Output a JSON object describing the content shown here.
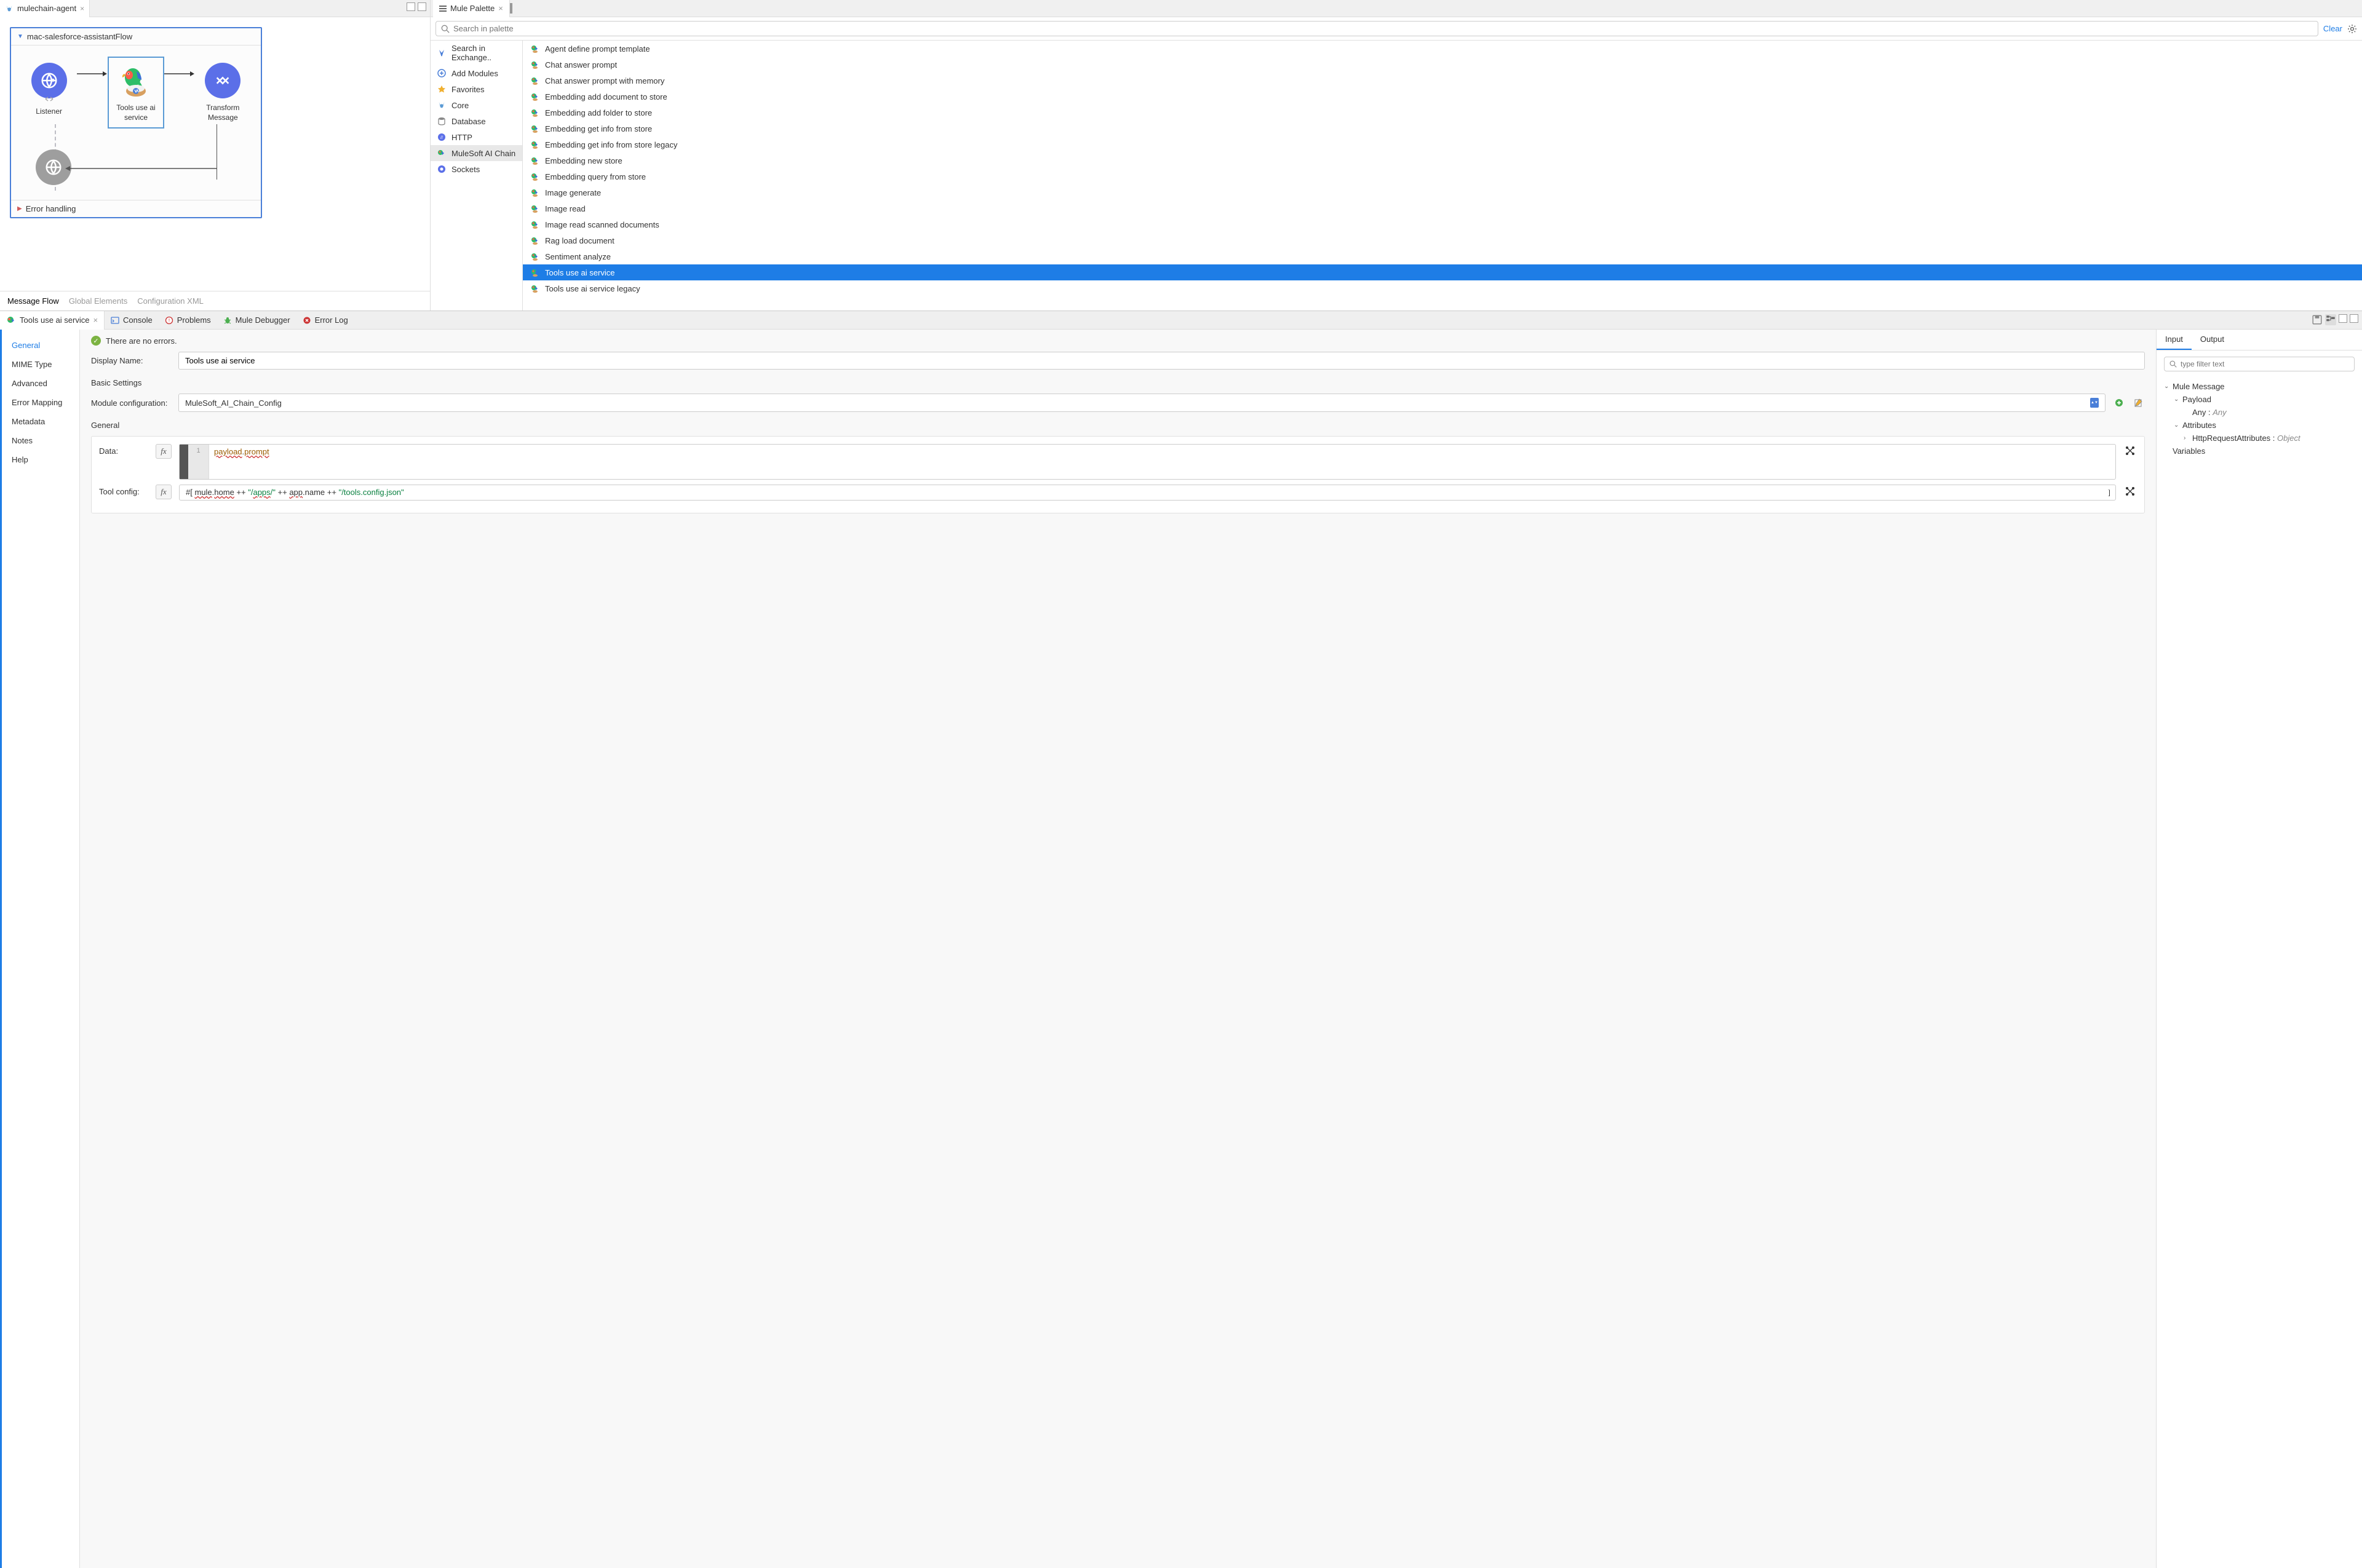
{
  "editor": {
    "tab_label": "mulechain-agent",
    "flow_name": "mac-salesforce-assistantFlow",
    "nodes": {
      "listener": "Listener",
      "tools": "Tools use ai service",
      "transform": "Transform Message"
    },
    "error_handling": "Error handling",
    "bottom_tabs": [
      "Message Flow",
      "Global Elements",
      "Configuration XML"
    ]
  },
  "palette": {
    "title": "Mule Palette",
    "search_placeholder": "Search in palette",
    "clear": "Clear",
    "left": [
      {
        "label": "Search in Exchange.."
      },
      {
        "label": "Add Modules"
      },
      {
        "label": "Favorites"
      },
      {
        "label": "Core"
      },
      {
        "label": "Database"
      },
      {
        "label": "HTTP"
      },
      {
        "label": "MuleSoft AI Chain",
        "selected": true
      },
      {
        "label": "Sockets"
      }
    ],
    "right": [
      {
        "label": "Agent define prompt template"
      },
      {
        "label": "Chat answer prompt"
      },
      {
        "label": "Chat answer prompt with memory"
      },
      {
        "label": "Embedding add document to store"
      },
      {
        "label": "Embedding add folder to store"
      },
      {
        "label": "Embedding get info from store"
      },
      {
        "label": "Embedding get info from store legacy"
      },
      {
        "label": "Embedding new store"
      },
      {
        "label": "Embedding query from store"
      },
      {
        "label": "Image generate"
      },
      {
        "label": "Image read"
      },
      {
        "label": "Image read scanned documents"
      },
      {
        "label": "Rag load document"
      },
      {
        "label": "Sentiment analyze"
      },
      {
        "label": "Tools use ai service",
        "selected": true
      },
      {
        "label": "Tools use ai service legacy"
      }
    ]
  },
  "properties": {
    "tab_label": "Tools use ai service",
    "view_tabs": [
      "Console",
      "Problems",
      "Mule Debugger",
      "Error Log"
    ],
    "sidebar": [
      "General",
      "MIME Type",
      "Advanced",
      "Error Mapping",
      "Metadata",
      "Notes",
      "Help"
    ],
    "no_errors": "There are no errors.",
    "display_name_label": "Display Name:",
    "display_name_value": "Tools use ai service",
    "basic_settings": "Basic Settings",
    "module_config_label": "Module configuration:",
    "module_config_value": "MuleSoft_AI_Chain_Config",
    "general": "General",
    "data_label": "Data:",
    "data_code_line": "1",
    "data_code": "payload.prompt",
    "tool_config_label": "Tool config:",
    "tool_config_value": "#[ mule.home ++ \"/apps/\" ++ app.name ++ \"/tools.config.json\""
  },
  "outline": {
    "tabs": [
      "Input",
      "Output"
    ],
    "filter_placeholder": "type filter text",
    "items": [
      {
        "label": "Mule Message",
        "depth": 0,
        "exp": true
      },
      {
        "label": "Payload",
        "depth": 1,
        "exp": true
      },
      {
        "label": "Any : ",
        "extra": "Any",
        "depth": 2
      },
      {
        "label": "Attributes",
        "depth": 1,
        "exp": true
      },
      {
        "label": "HttpRequestAttributes : ",
        "extra": "Object",
        "depth": 2,
        "chev": ">"
      },
      {
        "label": "Variables",
        "depth": 0
      }
    ]
  }
}
